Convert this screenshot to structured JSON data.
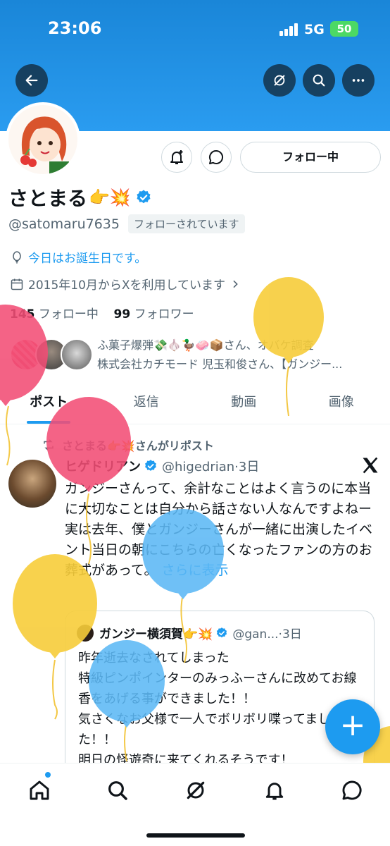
{
  "status_bar": {
    "time": "23:06",
    "network": "5G",
    "battery": "50"
  },
  "header": {
    "icons": [
      "back-arrow-icon",
      "grok-icon",
      "search-icon",
      "more-icon"
    ]
  },
  "profile_actions": {
    "follow_label": "フォロー中",
    "icons": [
      "notify-bell-icon",
      "message-icon"
    ]
  },
  "profile": {
    "name": "さとまる",
    "name_emojis": "👉💥",
    "handle": "@satomaru7635",
    "follows_you": "フォローされています",
    "birthday": "今日はお誕生日です。",
    "joined": "2015年10月からXを利用しています",
    "following_count": "145",
    "following_label": "フォロー中",
    "followers_count": "99",
    "followers_label": "フォロワー",
    "followed_by_line1": "ふ菓子爆弾💸🧄🦆🧼📦さん、オバケ調査",
    "followed_by_line2": "株式会社カチモード 児玉和俊さん、【ガンジー..."
  },
  "tabs": [
    {
      "label": "ポスト",
      "active": true
    },
    {
      "label": "返信",
      "active": false
    },
    {
      "label": "動画",
      "active": false
    },
    {
      "label": "画像",
      "active": false
    }
  ],
  "tweet": {
    "repost_by": "さとまる👉💥さんがリポスト",
    "author": "ヒゲドリアン",
    "handle": "@higedrian·3日",
    "body": "ガンジーさんって、余計なことはよく言うのに本当に大切なことは自分から話さない人なんですよねー\n実は去年、僕とガンジーさんが一緒に出演したイベント当日の朝にこちらの亡くなったファンの方のお葬式があって。",
    "show_more": "さらに表示",
    "quote": {
      "author": "ガンジー横須賀👉💥",
      "handle": "@gan...·3日",
      "body": "昨年逝去なされてしまった\n特級ピンポインターのみっふーさんに改めてお線香をあげる事ができました！！\n気さくなお父様で一人でボリボリ喋ってました！！\n明日の怪遊奇に来てくれるそうです！"
    }
  },
  "fab_label": "+",
  "bottom_nav": [
    "home-icon",
    "search-icon",
    "grok-icon",
    "notifications-icon",
    "messages-icon"
  ],
  "colors": {
    "accent": "#1d9bf0",
    "header_gradient_top": "#1a86d8",
    "balloon_pink": "#f24d75",
    "balloon_yellow": "#f7cd3a",
    "balloon_blue": "#5cb8f5"
  }
}
